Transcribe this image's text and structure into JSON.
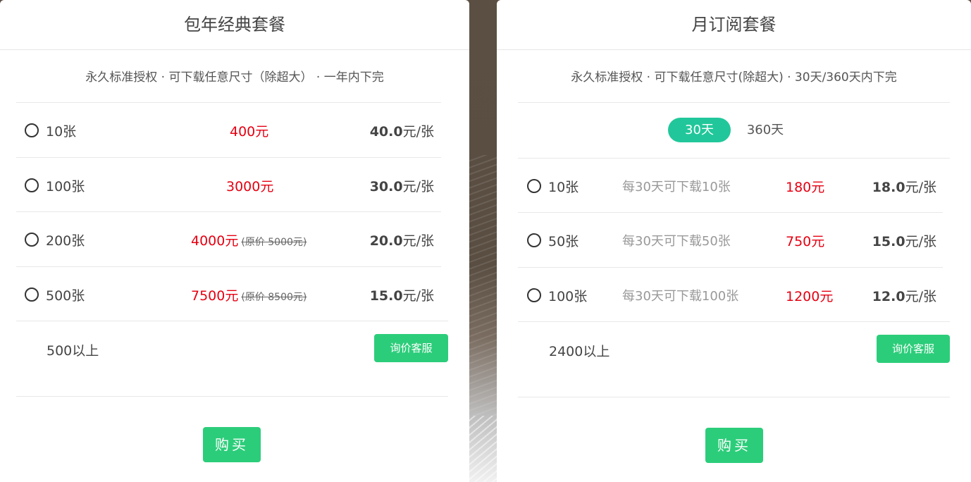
{
  "left": {
    "title": "包年经典套餐",
    "subtitle": "永久标准授权 · 可下载任意尺寸（除超大） · 一年内下完",
    "rows": [
      {
        "qty": "10张",
        "price": "400元",
        "original": "",
        "unit_value": "40.0",
        "unit_suffix": "元/张"
      },
      {
        "qty": "100张",
        "price": "3000元",
        "original": "",
        "unit_value": "30.0",
        "unit_suffix": "元/张"
      },
      {
        "qty": "200张",
        "price": "4000元",
        "original": "(原价 5000元)",
        "unit_value": "20.0",
        "unit_suffix": "元/张"
      },
      {
        "qty": "500张",
        "price": "7500元",
        "original": "(原价 8500元)",
        "unit_value": "15.0",
        "unit_suffix": "元/张"
      }
    ],
    "more_label": "500以上",
    "inquire_label": "询价客服",
    "buy_label": "购买"
  },
  "right": {
    "title": "月订阅套餐",
    "subtitle": "永久标准授权 · 可下载任意尺寸(除超大) · 30天/360天内下完",
    "tabs": [
      {
        "label": "30天",
        "active": true
      },
      {
        "label": "360天",
        "active": false
      }
    ],
    "rows": [
      {
        "qty": "10张",
        "desc": "每30天可下载10张",
        "price": "180元",
        "unit_value": "18.0",
        "unit_suffix": "元/张"
      },
      {
        "qty": "50张",
        "desc": "每30天可下载50张",
        "price": "750元",
        "unit_value": "15.0",
        "unit_suffix": "元/张"
      },
      {
        "qty": "100张",
        "desc": "每30天可下载100张",
        "price": "1200元",
        "unit_value": "12.0",
        "unit_suffix": "元/张"
      }
    ],
    "more_label": "2400以上",
    "inquire_label": "询价客服",
    "buy_label": "购买"
  },
  "colors": {
    "accent_green": "#2ccd7a",
    "tab_green": "#21c79a",
    "price_red": "#e60012"
  }
}
